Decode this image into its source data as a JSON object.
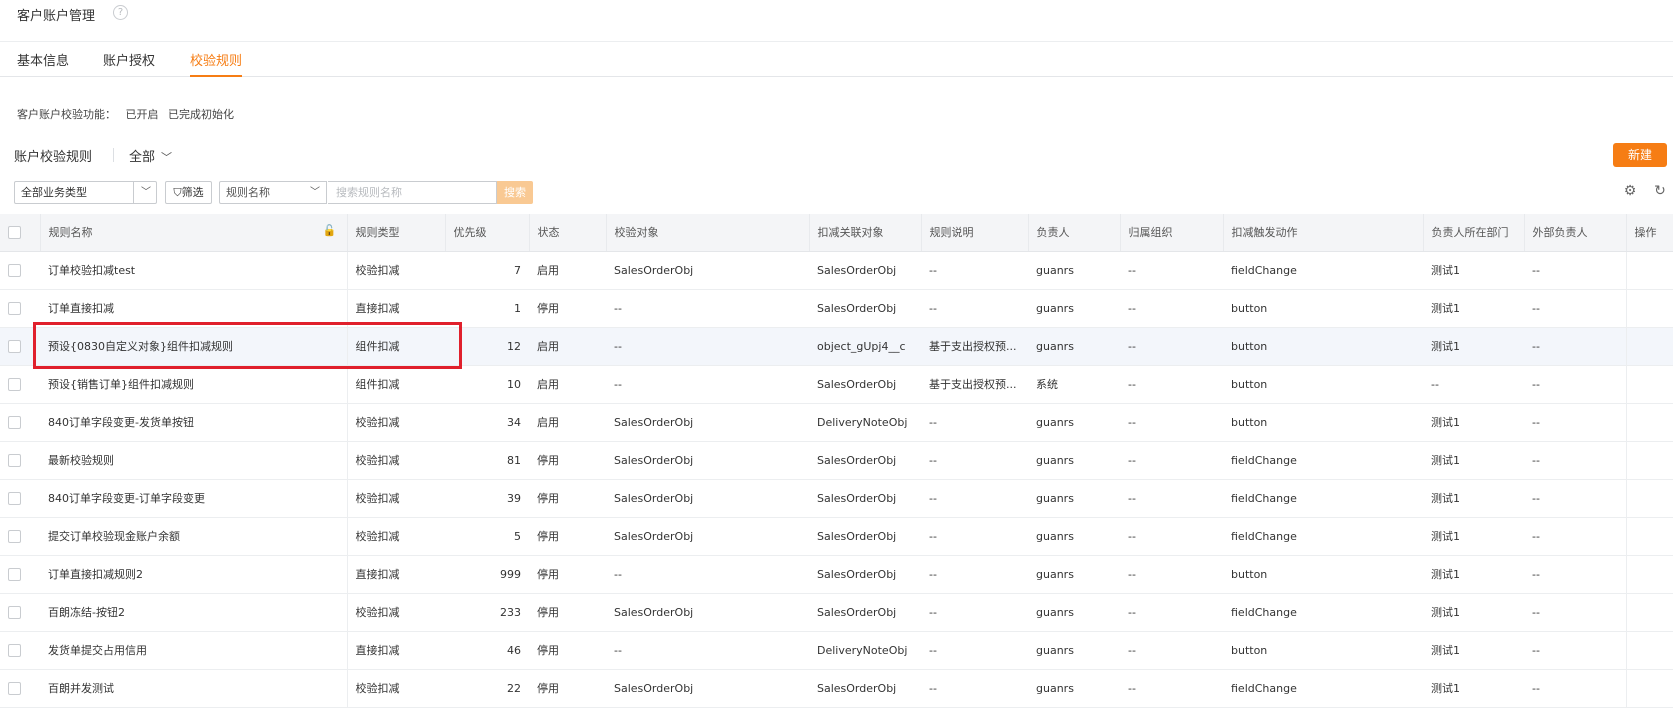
{
  "page": {
    "title": "客户账户管理",
    "help_icon": "?"
  },
  "tabs": [
    {
      "label": "基本信息",
      "active": false
    },
    {
      "label": "账户授权",
      "active": false
    },
    {
      "label": "校验规则",
      "active": true
    }
  ],
  "feature": {
    "label": "客户账户校验功能：",
    "status1": "已开启",
    "status2": "已完成初始化"
  },
  "section": {
    "title": "账户校验规则",
    "scope": "全部",
    "new_button": "新建"
  },
  "toolbar": {
    "biz_type": "全部业务类型",
    "filter_label": "筛选",
    "field_select": "规则名称",
    "search_placeholder": "搜索规则名称",
    "search_button": "搜索",
    "settings_icon": "gear-icon",
    "refresh_icon": "refresh-icon"
  },
  "columns": [
    "规则名称",
    "规则类型",
    "优先级",
    "状态",
    "校验对象",
    "扣减关联对象",
    "规则说明",
    "负责人",
    "归属组织",
    "扣减触发动作",
    "负责人所在部门",
    "外部负责人",
    "操作"
  ],
  "rows": [
    [
      "订单校验扣减test",
      "校验扣减",
      "7",
      "启用",
      "SalesOrderObj",
      "SalesOrderObj",
      "--",
      "guanrs",
      "--",
      "fieldChange",
      "测试1",
      "--"
    ],
    [
      "订单直接扣减",
      "直接扣减",
      "1",
      "停用",
      "--",
      "SalesOrderObj",
      "--",
      "guanrs",
      "--",
      "button",
      "测试1",
      "--"
    ],
    [
      "预设{0830自定义对象}组件扣减规则",
      "组件扣减",
      "12",
      "启用",
      "--",
      "object_gUpj4__c",
      "基于支出授权预...",
      "guanrs",
      "--",
      "button",
      "测试1",
      "--"
    ],
    [
      "预设{销售订单}组件扣减规则",
      "组件扣减",
      "10",
      "启用",
      "--",
      "SalesOrderObj",
      "基于支出授权预...",
      "系统",
      "--",
      "button",
      "--",
      "--"
    ],
    [
      "840订单字段变更-发货单按钮",
      "校验扣减",
      "34",
      "启用",
      "SalesOrderObj",
      "DeliveryNoteObj",
      "--",
      "guanrs",
      "--",
      "button",
      "测试1",
      "--"
    ],
    [
      "最新校验规则",
      "校验扣减",
      "81",
      "停用",
      "SalesOrderObj",
      "SalesOrderObj",
      "--",
      "guanrs",
      "--",
      "fieldChange",
      "测试1",
      "--"
    ],
    [
      "840订单字段变更-订单字段变更",
      "校验扣减",
      "39",
      "停用",
      "SalesOrderObj",
      "SalesOrderObj",
      "--",
      "guanrs",
      "--",
      "fieldChange",
      "测试1",
      "--"
    ],
    [
      "提交订单校验现金账户余额",
      "校验扣减",
      "5",
      "停用",
      "SalesOrderObj",
      "SalesOrderObj",
      "--",
      "guanrs",
      "--",
      "fieldChange",
      "测试1",
      "--"
    ],
    [
      "订单直接扣减规则2",
      "直接扣减",
      "999",
      "停用",
      "--",
      "SalesOrderObj",
      "--",
      "guanrs",
      "--",
      "button",
      "测试1",
      "--"
    ],
    [
      "百朗冻结-按钮2",
      "校验扣减",
      "233",
      "停用",
      "SalesOrderObj",
      "SalesOrderObj",
      "--",
      "guanrs",
      "--",
      "fieldChange",
      "测试1",
      "--"
    ],
    [
      "发货单提交占用信用",
      "直接扣减",
      "46",
      "停用",
      "--",
      "DeliveryNoteObj",
      "--",
      "guanrs",
      "--",
      "button",
      "测试1",
      "--"
    ],
    [
      "百朗并发测试",
      "校验扣减",
      "22",
      "停用",
      "SalesOrderObj",
      "SalesOrderObj",
      "--",
      "guanrs",
      "--",
      "fieldChange",
      "测试1",
      "--"
    ]
  ],
  "highlight_color": "#e0202c",
  "accent_color": "#f67d14"
}
